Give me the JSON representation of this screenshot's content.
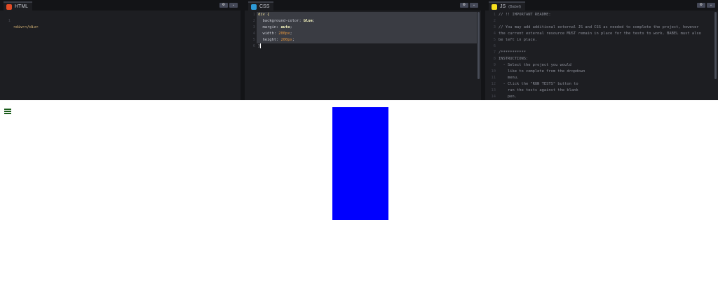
{
  "editors": {
    "html": {
      "label": "HTML",
      "badge_color": "#e34c26",
      "lines": [
        "<div></div>"
      ]
    },
    "css": {
      "label": "CSS",
      "badge_color": "#2d9bd8",
      "lines": [
        "div {",
        "  background-color: blue;",
        "  margin: auto;",
        "  width: 200px;",
        "  height: 200px;",
        "}"
      ]
    },
    "js": {
      "label": "JS",
      "sublabel": "(Babel)",
      "badge_color": "#f7df1e",
      "lines": [
        "// !! IMPORTANT README:",
        "",
        "// You may add additional external JS and CSS as needed to complete the project, however",
        "the current external resource MUST remain in place for the tests to work. BABEL must also",
        "be left in place.",
        "",
        "/***********",
        "INSTRUCTIONS:",
        "  - Select the project you would",
        "    like to complete from the dropdown",
        "    menu.",
        "  - Click the \"RUN TESTS\" button to",
        "    run the tests against the blank",
        "    pen."
      ]
    }
  },
  "preview": {
    "box_color": "#0000ff"
  }
}
